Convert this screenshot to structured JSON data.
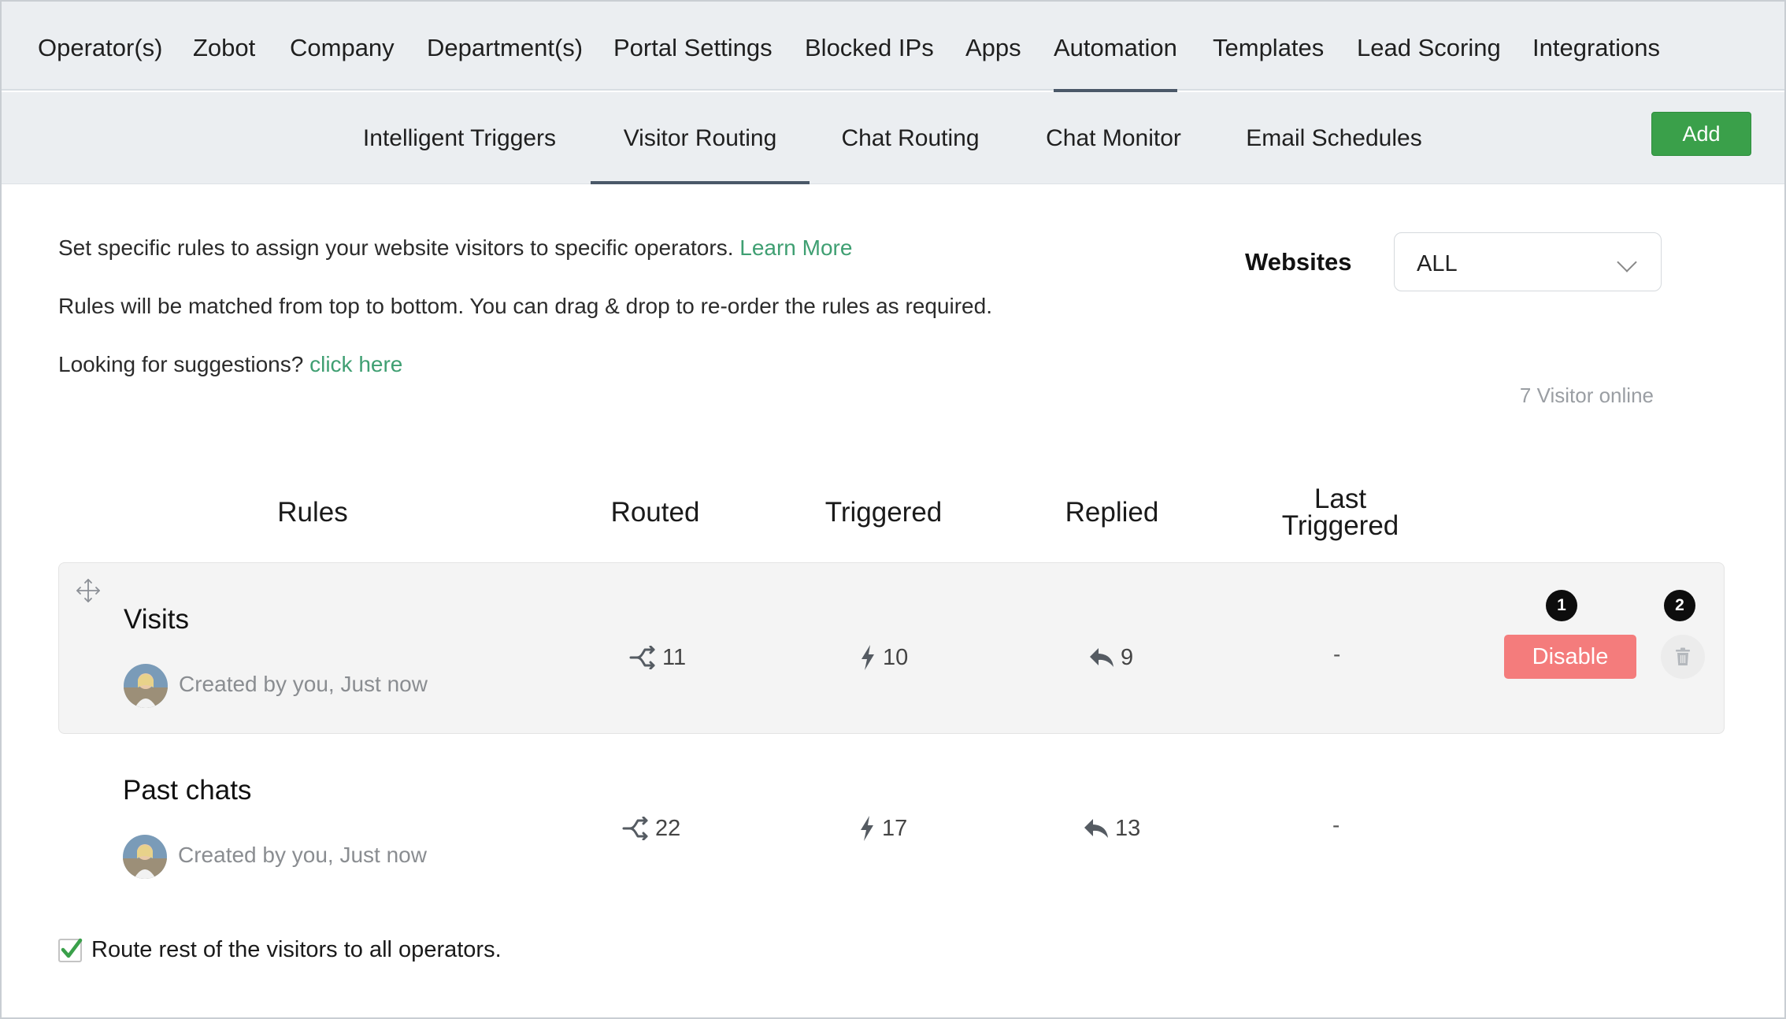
{
  "top_nav": {
    "items": [
      {
        "label": "Operator(s)",
        "active": false
      },
      {
        "label": "Zobot",
        "active": false
      },
      {
        "label": "Company",
        "active": false
      },
      {
        "label": "Department(s)",
        "active": false
      },
      {
        "label": "Portal Settings",
        "active": false
      },
      {
        "label": "Blocked IPs",
        "active": false
      },
      {
        "label": "Apps",
        "active": false
      },
      {
        "label": "Automation",
        "active": true
      },
      {
        "label": "Templates",
        "active": false
      },
      {
        "label": "Lead Scoring",
        "active": false
      },
      {
        "label": "Integrations",
        "active": false
      }
    ]
  },
  "sub_nav": {
    "tabs": [
      {
        "label": "Intelligent Triggers",
        "active": false
      },
      {
        "label": "Visitor Routing",
        "active": true
      },
      {
        "label": "Chat Routing",
        "active": false
      },
      {
        "label": "Chat Monitor",
        "active": false
      },
      {
        "label": "Email Schedules",
        "active": false
      }
    ],
    "add_label": "Add"
  },
  "intro": {
    "line1": "Set specific rules to assign your website visitors to specific operators.",
    "learn_more": "Learn More",
    "line2": "Rules will be matched from top to bottom. You can drag & drop to re-order the rules as required.",
    "line3": "Looking for suggestions?",
    "click_here": "click here"
  },
  "websites": {
    "label": "Websites",
    "selected": "ALL"
  },
  "visitors_online": "7 Visitor online",
  "table": {
    "headers": {
      "rules": "Rules",
      "routed": "Routed",
      "triggered": "Triggered",
      "replied": "Replied",
      "last_triggered_1": "Last",
      "last_triggered_2": "Triggered"
    },
    "rows": [
      {
        "name": "Visits",
        "creator": "Created by you, Just now",
        "routed": "11",
        "triggered": "10",
        "replied": "9",
        "last_triggered": "-",
        "disable_label": "Disable",
        "badge_disable": "1",
        "badge_delete": "2"
      },
      {
        "name": "Past chats",
        "creator": "Created by you, Just now",
        "routed": "22",
        "triggered": "17",
        "replied": "13",
        "last_triggered": "-"
      }
    ]
  },
  "footer": {
    "route_rest_label": "Route rest of the visitors to all operators.",
    "route_rest_checked": true
  },
  "colors": {
    "accent_green": "#3aa04a",
    "link_green": "#3f9f72",
    "disable_red": "#f47c7c",
    "nav_bg": "#ebeef1"
  }
}
